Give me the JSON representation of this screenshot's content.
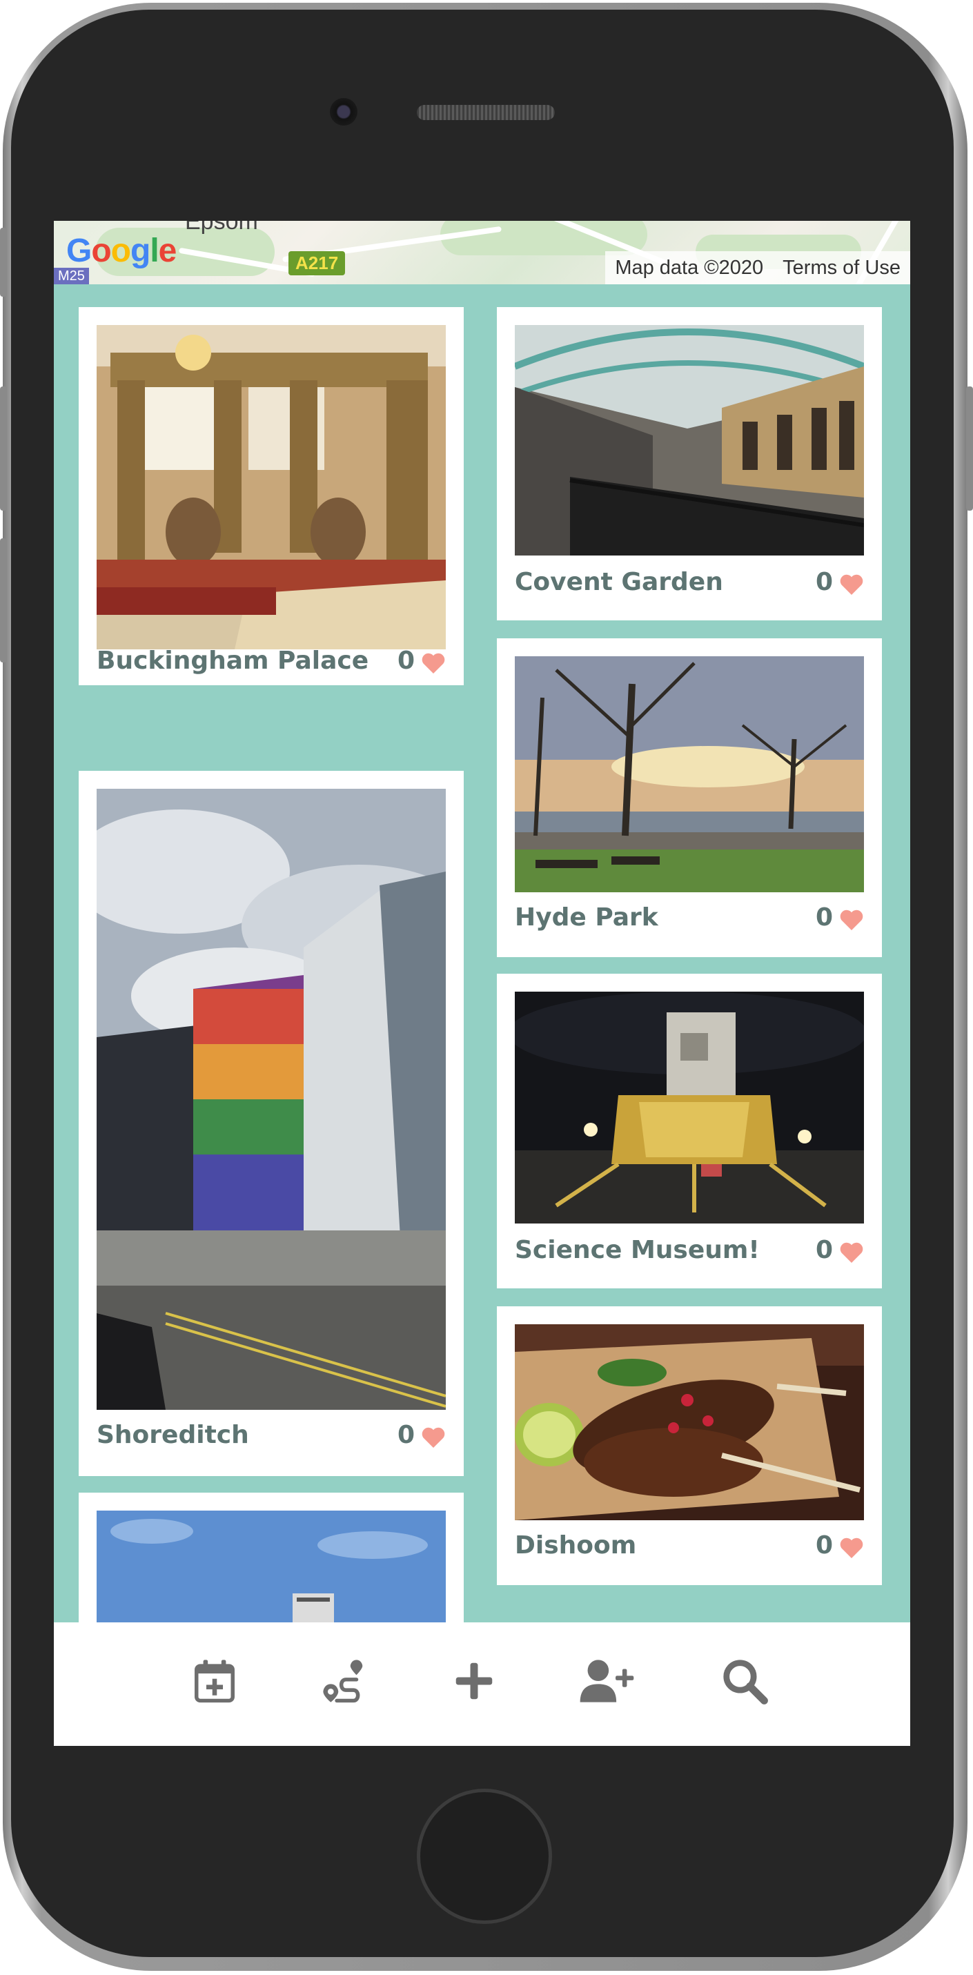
{
  "map": {
    "logo": [
      "G",
      "o",
      "o",
      "g",
      "l",
      "e"
    ],
    "logo_colors": [
      "#4285f4",
      "#ea4335",
      "#fbbc05",
      "#4285f4",
      "#34a853",
      "#ea4335"
    ],
    "town_label": "Epsom",
    "road_sign": "A217",
    "road_sign_left": "M25",
    "map_data": "Map data ©2020",
    "terms": "Terms of Use"
  },
  "places": [
    {
      "name": "Buckingham Palace",
      "likes": "0"
    },
    {
      "name": "Shoreditch",
      "likes": "0"
    },
    {
      "name": "Covent Garden",
      "likes": "0"
    },
    {
      "name": "Hyde Park",
      "likes": "0"
    },
    {
      "name": "Science Museum!",
      "likes": "0"
    },
    {
      "name": "Dishoom",
      "likes": "0"
    }
  ],
  "nav": {
    "items": [
      "calendar-add-icon",
      "route-icon",
      "add-icon",
      "add-user-icon",
      "search-icon"
    ]
  },
  "colors": {
    "accent": "#93d0c4",
    "text": "#5d7472",
    "heart": "#f59a8e",
    "icon": "#6e6e6e"
  }
}
